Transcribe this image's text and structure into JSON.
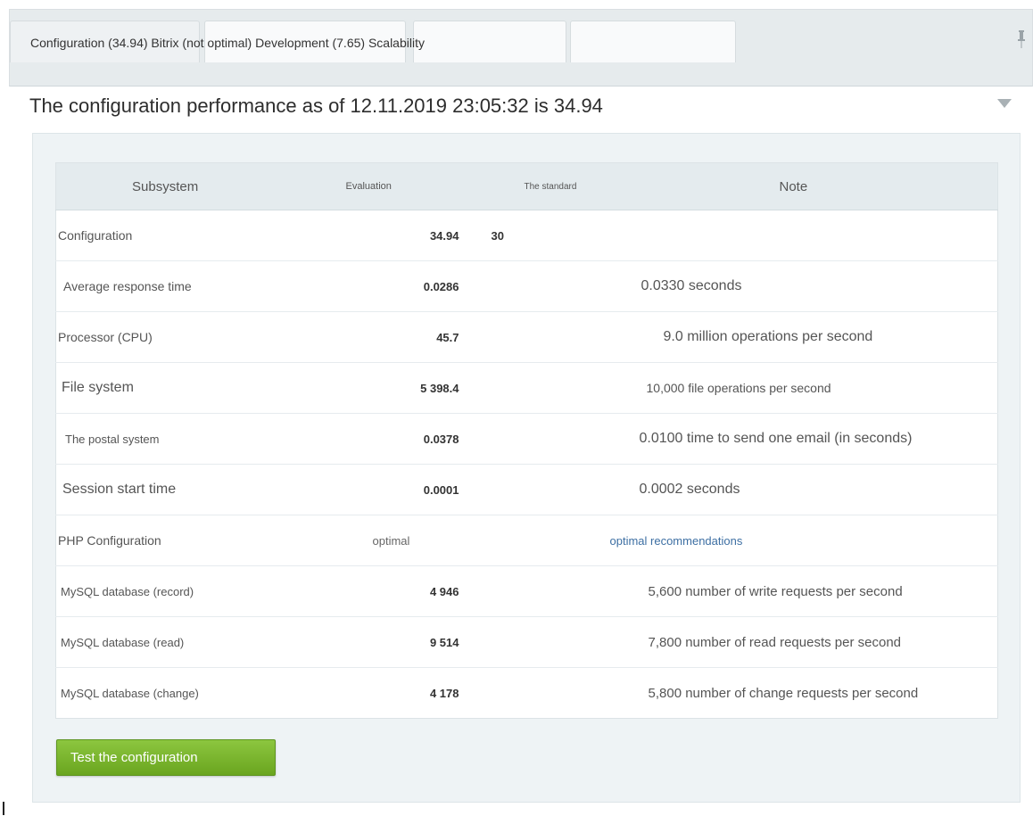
{
  "tabs": {
    "labels_line": "Configuration (34.94) Bitrix (not optimal) Development (7.65) Scalability"
  },
  "heading": "The configuration performance as of 12.11.2019 23:05:32 is 34.94",
  "table": {
    "headers": {
      "subsystem": "Subsystem",
      "evaluation": "Evaluation",
      "standard": "The standard",
      "note": "Note"
    },
    "rows": [
      {
        "subsystem": "Configuration",
        "evaluation": "34.94",
        "standard": "30",
        "note": ""
      },
      {
        "subsystem": "Average response time",
        "evaluation": "0.0286",
        "standard": "",
        "note": "0.0330 seconds"
      },
      {
        "subsystem": "Processor (CPU)",
        "evaluation": "45.7",
        "standard": "",
        "note": "9.0 million operations per second"
      },
      {
        "subsystem": "File system",
        "evaluation": "5 398.4",
        "standard": "",
        "note": "10,000 file operations per second"
      },
      {
        "subsystem": "The postal system",
        "evaluation": "0.0378",
        "standard": "",
        "note": "0.0100 time to send one email (in seconds)"
      },
      {
        "subsystem": "Session start time",
        "evaluation": "0.0001",
        "standard": "",
        "note": "0.0002 seconds"
      },
      {
        "subsystem": "PHP Configuration",
        "evaluation": "optimal",
        "standard": "",
        "note": "optimal recommendations"
      },
      {
        "subsystem": "MySQL database (record)",
        "evaluation": "4 946",
        "standard": "",
        "note": "5,600 number of write requests per second"
      },
      {
        "subsystem": "MySQL database (read)",
        "evaluation": "9 514",
        "standard": "",
        "note": "7,800 number of read requests per second"
      },
      {
        "subsystem": "MySQL database (change)",
        "evaluation": "4 178",
        "standard": "",
        "note": "5,800 number of change requests per second"
      }
    ]
  },
  "button": {
    "label": "Test the configuration"
  },
  "colors": {
    "button_green": "#7ab82e",
    "link_blue": "#3d6fa3",
    "header_bg": "#e4ebee"
  },
  "icons": {
    "pin": "pin-icon",
    "toggle": "triangle-down-icon"
  }
}
